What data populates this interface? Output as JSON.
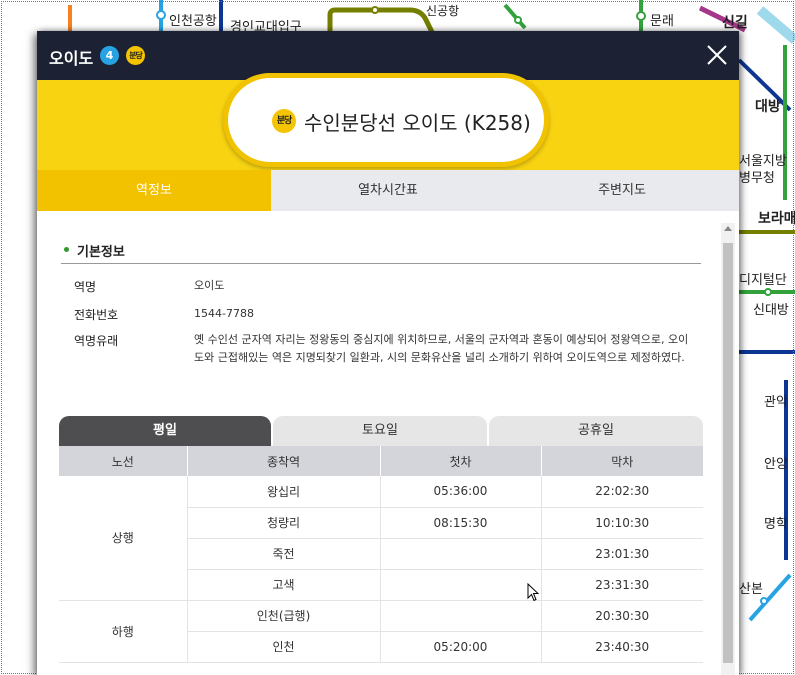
{
  "background_map": {
    "labels": {
      "incheon_airport": "인천공항",
      "gyeongin_univ": "경인교대입구",
      "sindorim_top": "신공항",
      "mullae": "문래",
      "singil": "신길",
      "daebang": "대방",
      "seoul_hospital": "서울지방\n병무청",
      "borame": "보라매",
      "digital": "디지털단",
      "sindaebang": "신대방",
      "gwanak": "관악",
      "anyang": "안양",
      "myeonghak": "명학",
      "sanbon": "산본"
    },
    "colors": {
      "line1": "#0d3692",
      "line2": "#33a23d",
      "line7": "#747f00",
      "orange": "#f5821f",
      "cyan": "#27a2e2",
      "magenta": "#a4378a"
    }
  },
  "popup": {
    "title": "오이도",
    "line_badges": [
      "4",
      "분당"
    ],
    "banner": {
      "badge": "분당",
      "station_name": "수인분당선 오이도 (K258)"
    },
    "tabs": [
      {
        "label": "역정보",
        "active": true
      },
      {
        "label": "열차시간표",
        "active": false
      },
      {
        "label": "주변지도",
        "active": false
      }
    ],
    "section_title": "기본정보",
    "info": [
      {
        "label": "역명",
        "value": "오이도"
      },
      {
        "label": "전화번호",
        "value": "1544-7788"
      },
      {
        "label": "역명유래",
        "value": "옛 수인선 군자역 자리는 정왕동의 중심지에 위치하므로, 서울의 군자역과 혼동이 예상되어 정왕역으로, 오이도와 근접해있는 역은 지명되찾기 일환과, 시의 문화유산을 널리 소개하기 위하여 오이도역으로 제정하였다."
      }
    ],
    "day_tabs": [
      {
        "label": "평일",
        "active": true
      },
      {
        "label": "토요일",
        "active": false
      },
      {
        "label": "공휴일",
        "active": false
      }
    ],
    "timetable": {
      "headers": [
        "노선",
        "종착역",
        "첫차",
        "막차"
      ],
      "groups": [
        {
          "direction": "상행",
          "rows": [
            {
              "terminal": "왕십리",
              "first": "05:36:00",
              "last": "22:02:30"
            },
            {
              "terminal": "청량리",
              "first": "08:15:30",
              "last": "10:10:30"
            },
            {
              "terminal": "죽전",
              "first": "",
              "last": "23:01:30"
            },
            {
              "terminal": "고색",
              "first": "",
              "last": "23:31:30"
            }
          ]
        },
        {
          "direction": "하행",
          "rows": [
            {
              "terminal": "인천(급행)",
              "first": "",
              "last": "20:30:30"
            },
            {
              "terminal": "인천",
              "first": "05:20:00",
              "last": "23:40:30"
            }
          ]
        }
      ]
    }
  }
}
